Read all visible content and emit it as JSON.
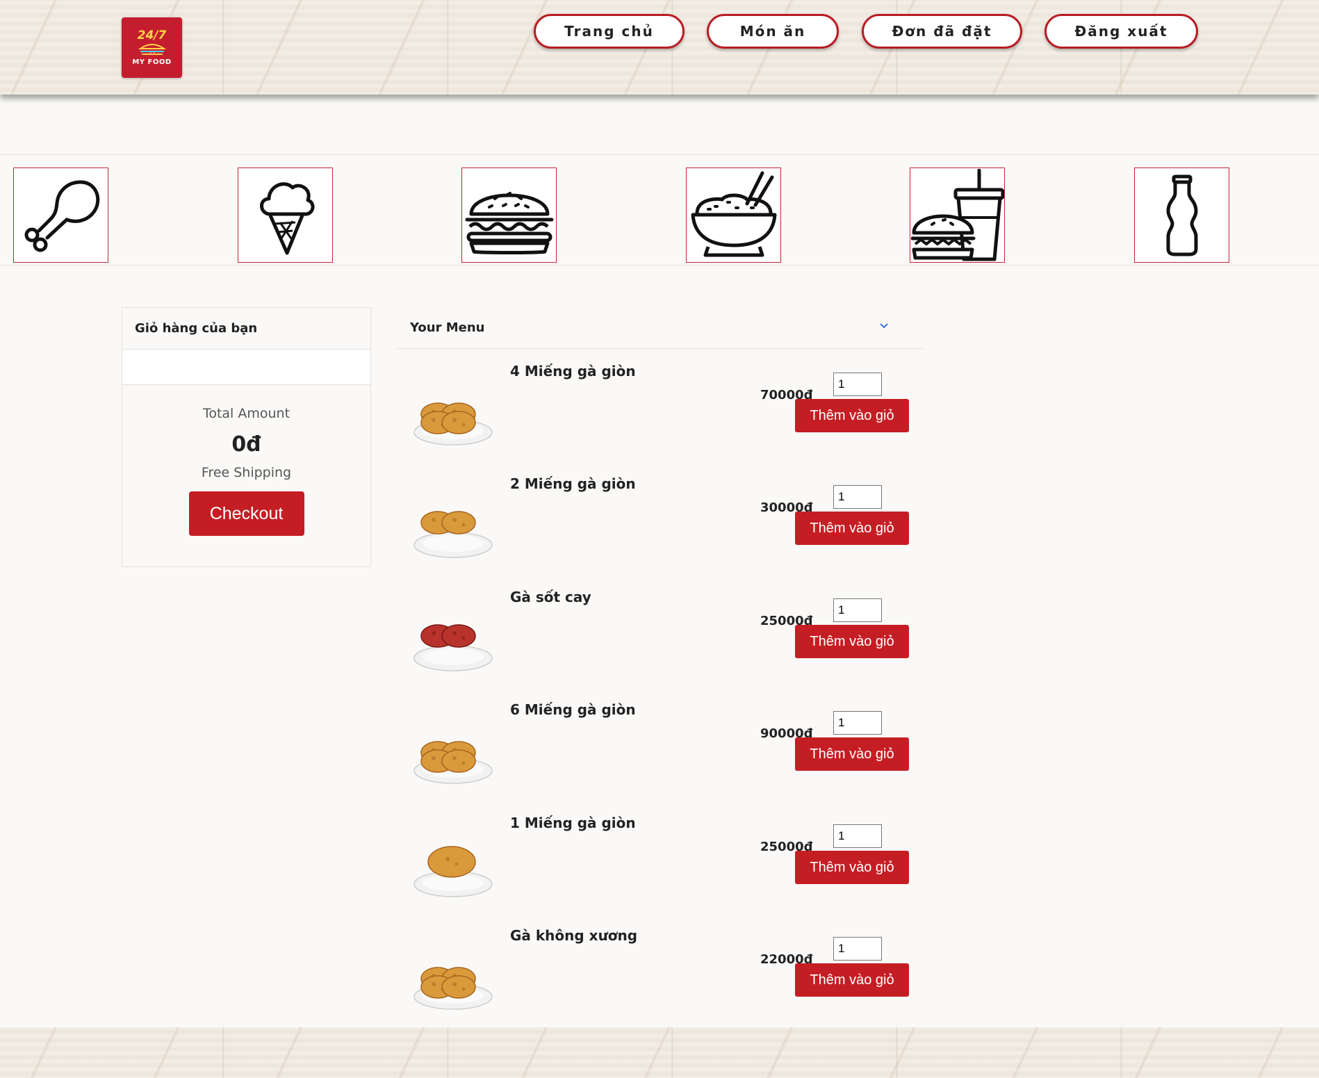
{
  "header": {
    "logo": {
      "top_text": "24/7",
      "bottom_text": "MY FOOD"
    },
    "nav": [
      {
        "label": "Trang chủ"
      },
      {
        "label": "Món ăn"
      },
      {
        "label": "Đơn đã đặt"
      },
      {
        "label": "Đăng xuất"
      }
    ]
  },
  "categories": [
    {
      "icon": "chicken-leg-icon"
    },
    {
      "icon": "ice-cream-icon"
    },
    {
      "icon": "burger-icon"
    },
    {
      "icon": "rice-bowl-icon"
    },
    {
      "icon": "burger-drink-combo-icon"
    },
    {
      "icon": "soda-bottle-icon"
    }
  ],
  "cart": {
    "title": "Giỏ hàng của bạn",
    "total_label": "Total Amount",
    "total_value": "0đ",
    "shipping": "Free Shipping",
    "checkout_label": "Checkout"
  },
  "menu": {
    "title": "Your Menu",
    "add_label": "Thêm vào giỏ",
    "items": [
      {
        "name": "4 Miếng gà giòn",
        "price": "70000đ",
        "qty": "1"
      },
      {
        "name": "2 Miếng gà giòn",
        "price": "30000đ",
        "qty": "1"
      },
      {
        "name": "Gà sốt cay",
        "price": "25000đ",
        "qty": "1"
      },
      {
        "name": "6 Miếng gà giòn",
        "price": "90000đ",
        "qty": "1"
      },
      {
        "name": "1 Miếng gà giòn",
        "price": "25000đ",
        "qty": "1"
      },
      {
        "name": "Gà không xương",
        "price": "22000đ",
        "qty": "1"
      }
    ]
  },
  "colors": {
    "accent": "#c41e24",
    "nav_border": "#b81c24",
    "background": "#faf9f7"
  }
}
